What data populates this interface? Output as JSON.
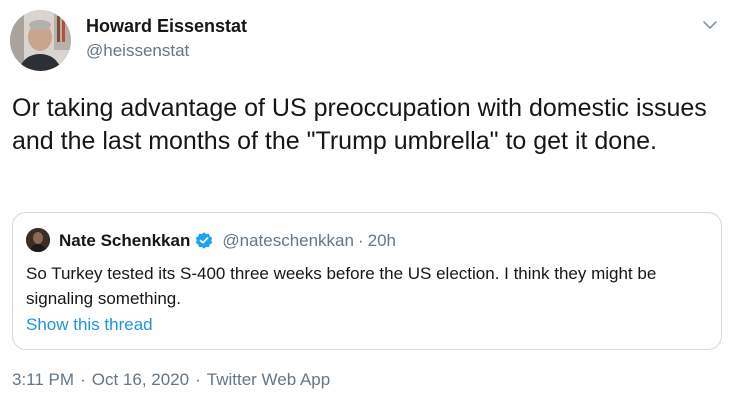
{
  "author": {
    "name": "Howard Eissenstat",
    "handle": "@heissenstat"
  },
  "tweet": {
    "text": "Or taking advantage of US preoccupation with domestic issues and the last months of the \"Trump umbrella\" to get it done."
  },
  "quoted_tweet": {
    "name": "Nate Schenkkan",
    "handle": "@nateschenkkan",
    "separator": "·",
    "time": "20h",
    "text": "So Turkey tested its S-400 three weeks before the US election. I think they might be signaling something.",
    "show_thread_label": "Show this thread"
  },
  "footer": {
    "time": "3:11 PM",
    "separator": "·",
    "date": "Oct 16, 2020",
    "source": "Twitter Web App"
  },
  "colors": {
    "text": "#14171a",
    "secondary": "#657786",
    "link": "#1b95e0",
    "verified": "#1da1f2",
    "border": "#cfd9de"
  },
  "icons": {
    "menu": "chevron-down-icon",
    "verified": "verified-badge-icon"
  }
}
